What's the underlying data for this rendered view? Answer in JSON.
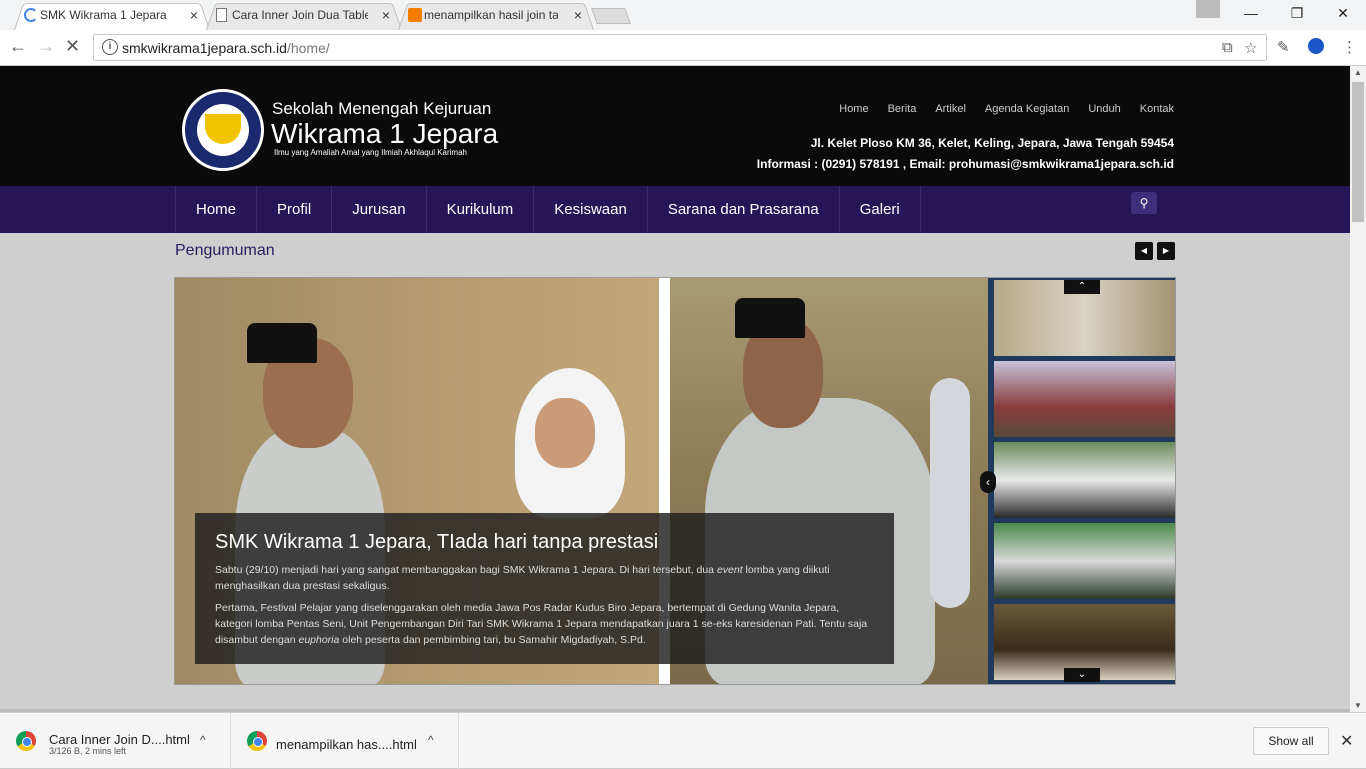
{
  "browser": {
    "tabs": [
      {
        "title": "SMK Wikrama 1 Jepara",
        "close": "×"
      },
      {
        "title": "Cara Inner Join Dua Table",
        "close": "×"
      },
      {
        "title": "menampilkan hasil join ta",
        "close": "×"
      }
    ],
    "window": {
      "minimize": "—",
      "restore": "❐",
      "close": "✕"
    },
    "nav": {
      "back": "←",
      "forward": "→",
      "stop": "✕"
    },
    "url": {
      "host": "smkwikrama1jepara.sch.id",
      "path": "/home/"
    },
    "info_icon": "i",
    "translate_icon": "⧉",
    "star_icon": "☆",
    "ext_icon": "✎",
    "menu_icon": "⋮"
  },
  "site": {
    "school_sub": "Sekolah Menengah Kejuruan",
    "school_name": "Wikrama 1 Jepara",
    "tagline": "Ilmu yang Amaliah Amal yang Ilmiah Akhlaqul Karimah",
    "top_nav": [
      "Home",
      "Berita",
      "Artikel",
      "Agenda Kegiatan",
      "Unduh",
      "Kontak"
    ],
    "address": "Jl. Kelet Ploso KM 36, Kelet, Keling, Jepara, Jawa Tengah 59454",
    "contact": "Informasi : (0291) 578191 , Email: prohumasi@smkwikrama1jepara.sch.id",
    "main_nav": [
      "Home",
      "Profil",
      "Jurusan",
      "Kurikulum",
      "Kesiswaan",
      "Sarana dan Prasarana",
      "Galeri"
    ],
    "search_icon": "⚲",
    "announcement": "Pengumuman",
    "prev": "◀",
    "next": "▶",
    "slide": {
      "title": "SMK Wikrama 1 Jepara, TIada hari tanpa prestasi",
      "p1_a": "Sabtu (29/10) menjadi hari yang sangat membanggakan bagi SMK Wikrama 1 Jepara. Di hari tersebut, dua ",
      "p1_em": "event",
      "p1_b": " lomba yang diikuti menghasilkan dua prestasi sekaligus.",
      "p2_a": "Pertama, Festival Pelajar yang diselenggarakan oleh media Jawa Pos Radar Kudus Biro Jepara, bertempat di Gedung Wanita Jepara, kategori lomba Pentas Seni, Unit Pengembangan Diri Tari SMK Wikrama 1 Jepara mendapatkan juara 1 se-eks karesidenan Pati. Tentu saja disambut dengan ",
      "p2_em": "euphoria",
      "p2_b": " oleh peserta dan pembimbing tari, bu Samahir Migdadiyah, S.Pd."
    },
    "thumb_up": "⌃",
    "thumb_down": "⌄",
    "thumb_left": "‹"
  },
  "downloads": [
    {
      "name": "Cara Inner Join D....html",
      "meta": "3/126 B, 2 mins left",
      "chevron": "^"
    },
    {
      "name": "menampilkan has....html",
      "chevron": "^"
    }
  ],
  "show_all": "Show all",
  "dl_close": "✕"
}
